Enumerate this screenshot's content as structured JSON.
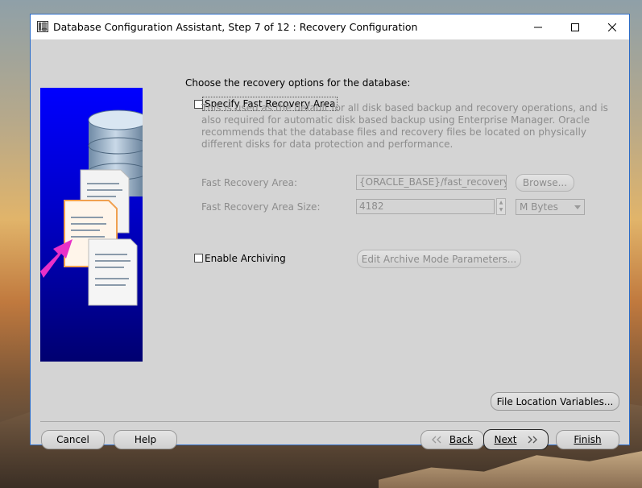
{
  "window": {
    "title": "Database Configuration Assistant, Step 7 of 12 : Recovery Configuration"
  },
  "page": {
    "heading": "Choose the recovery options for the database:",
    "fast_recovery": {
      "checkbox_label": "Specify Fast Recovery Area",
      "checked": false,
      "description": "This is used as the default for all disk based backup and recovery operations, and is also required for automatic disk based backup using Enterprise Manager. Oracle recommends that the database files and recovery files be located on physically different disks for data protection and performance.",
      "area_label": "Fast Recovery Area:",
      "area_value": "{ORACLE_BASE}/fast_recovery_a",
      "browse_label": "Browse...",
      "size_label": "Fast Recovery Area Size:",
      "size_value": "4182",
      "unit_value": "M Bytes"
    },
    "archiving": {
      "checkbox_label": "Enable Archiving",
      "checked": false,
      "edit_params_label": "Edit Archive Mode Parameters..."
    },
    "file_location_label": "File Location Variables..."
  },
  "footer": {
    "cancel_label": "Cancel",
    "help_label": "Help",
    "back_label": "Back",
    "next_label": "Next",
    "finish_label": "Finish"
  },
  "icons": {
    "app": "database-app-icon",
    "minimize": "minimize-icon",
    "maximize": "maximize-icon",
    "close": "close-icon",
    "back": "chevron-left-icon",
    "next": "chevron-right-icon"
  },
  "colors": {
    "window_bg": "#d4d4d4",
    "side_panel_blue": "#0000ff",
    "arrow_magenta": "#e830c8"
  }
}
